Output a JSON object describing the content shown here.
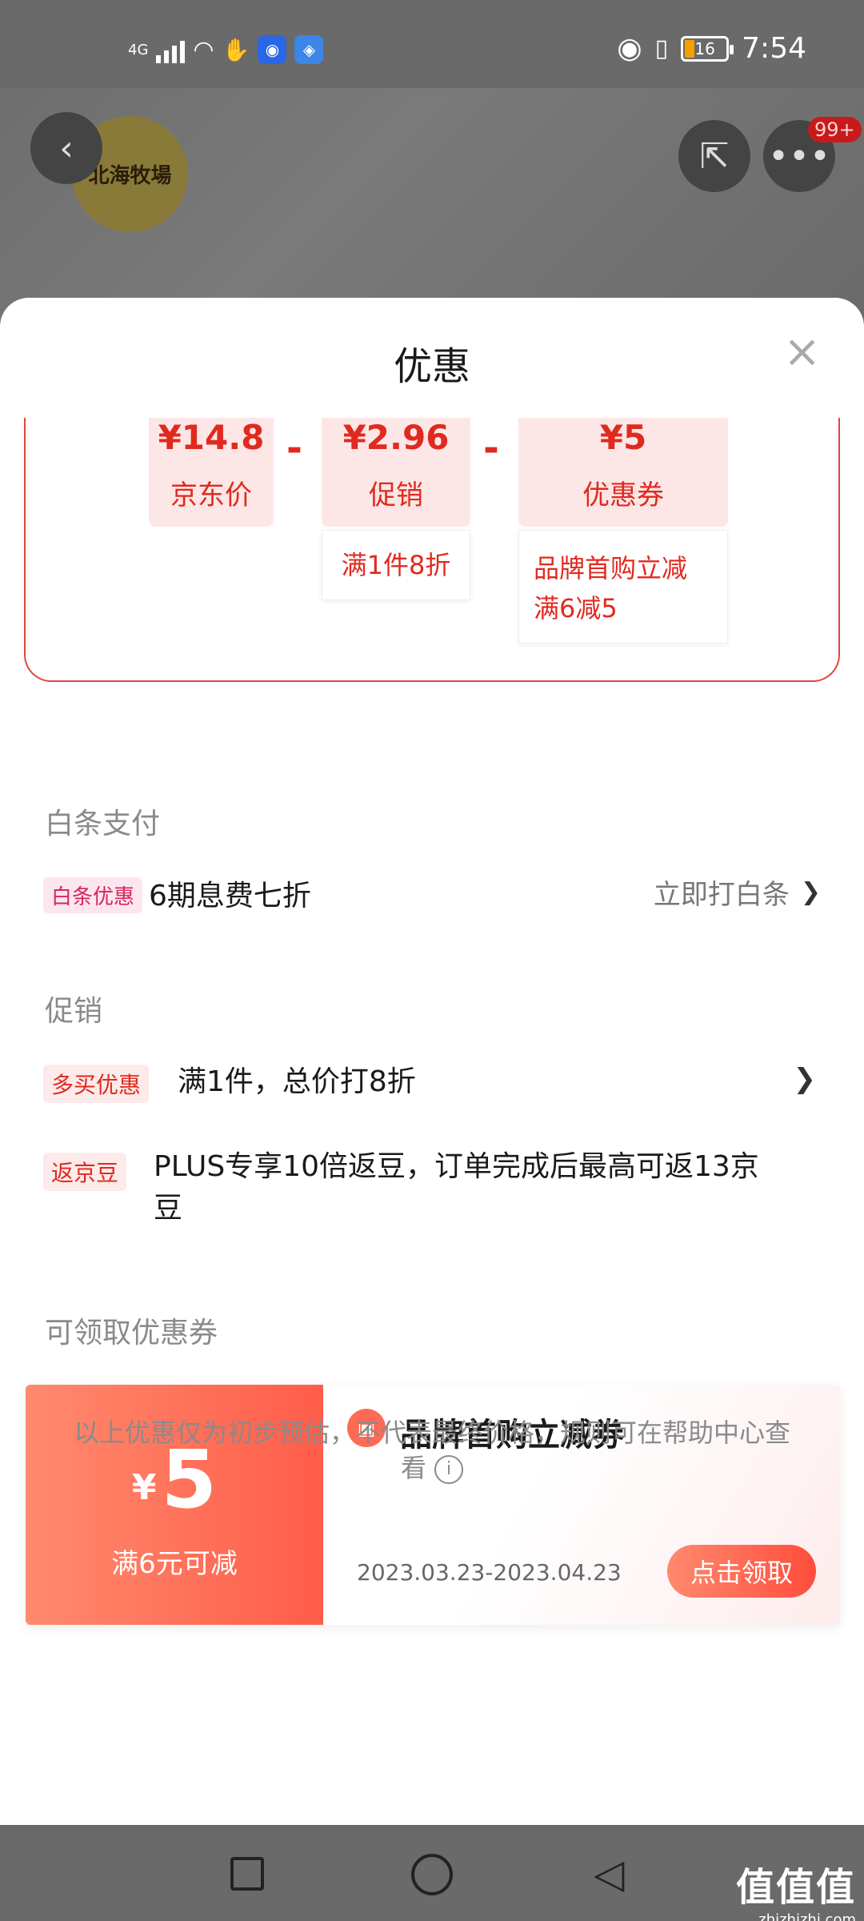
{
  "status_bar": {
    "network": "4G",
    "battery": "16",
    "time": "7:54"
  },
  "header": {
    "logo_text": "北海牧場",
    "badge": "99+"
  },
  "sheet": {
    "title": "优惠",
    "calc": {
      "jd_price": {
        "amount": "¥14.8",
        "label": "京东价"
      },
      "promo": {
        "amount": "¥2.96",
        "label": "促销",
        "detail": "满1件8折"
      },
      "coupon": {
        "amount": "¥5",
        "label": "优惠券",
        "detail_line1": "品牌首购立减",
        "detail_line2": "满6减5"
      },
      "minus": "-"
    },
    "baitiao": {
      "section_title": "白条支付",
      "tag": "白条优惠",
      "text": "6期息费七折",
      "action": "立即打白条",
      "chevron": "❯"
    },
    "promotion": {
      "section_title": "促销",
      "rows": [
        {
          "tag": "多买优惠",
          "text": "满1件，总价打8折",
          "chevron": "❯"
        },
        {
          "tag": "返京豆",
          "text_line1": "PLUS专享10倍返豆，订单完成后最高可返13京",
          "text_line2": "豆"
        }
      ]
    },
    "coupons": {
      "section_title": "可领取优惠券",
      "items": [
        {
          "currency": "¥",
          "amount": "5",
          "condition": "满6元可减",
          "title": "品牌首购立减券",
          "validity": "2023.03.23-2023.04.23",
          "action": "点击领取"
        }
      ]
    },
    "disclaimer_line1": "以上优惠仅为初步预估，不代表最终价格，规则可在帮助中心查",
    "disclaimer_line2": "看"
  },
  "watermark": {
    "main": "值值值",
    "sub": "zhizhizhi.com"
  }
}
